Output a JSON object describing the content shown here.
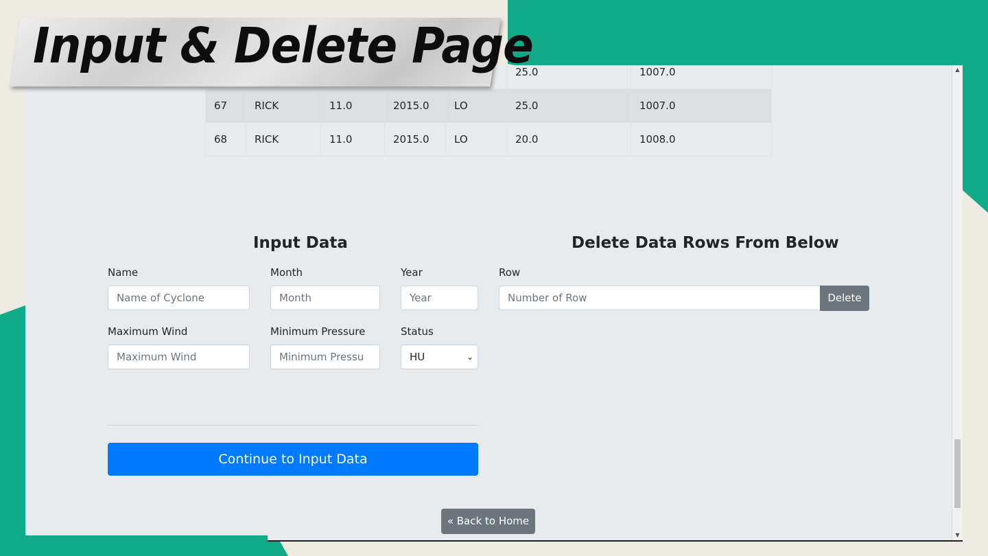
{
  "page_title": "Input & Delete Page",
  "table": {
    "rows": [
      {
        "cells": [
          "",
          "",
          "",
          "",
          "",
          "25.0",
          "1007.0"
        ]
      },
      {
        "cells": [
          "67",
          "RICK",
          "11.0",
          "2015.0",
          "LO",
          "25.0",
          "1007.0"
        ]
      },
      {
        "cells": [
          "68",
          "RICK",
          "11.0",
          "2015.0",
          "LO",
          "20.0",
          "1008.0"
        ]
      }
    ]
  },
  "input_section": {
    "title": "Input Data",
    "name_label": "Name",
    "name_placeholder": "Name of Cyclone",
    "month_label": "Month",
    "month_placeholder": "Month",
    "year_label": "Year",
    "year_placeholder": "Year",
    "wind_label": "Maximum Wind",
    "wind_placeholder": "Maximum Wind",
    "pressure_label": "Minimum Pressure",
    "pressure_placeholder": "Minimum Pressu",
    "status_label": "Status",
    "status_value": "HU",
    "continue_button": "Continue to Input Data"
  },
  "delete_section": {
    "title": "Delete Data Rows From Below",
    "row_label": "Row",
    "row_placeholder": "Number of Row",
    "delete_button": "Delete"
  },
  "back_button": "« Back to Home",
  "colors": {
    "accent_green": "#12ab8a",
    "primary_blue": "#007bff",
    "secondary_gray": "#6c757d"
  },
  "icons": {
    "select_arrow": "chevron-down-icon",
    "scroll_up": "scroll-up-arrow-icon",
    "scroll_down": "scroll-down-arrow-icon"
  }
}
